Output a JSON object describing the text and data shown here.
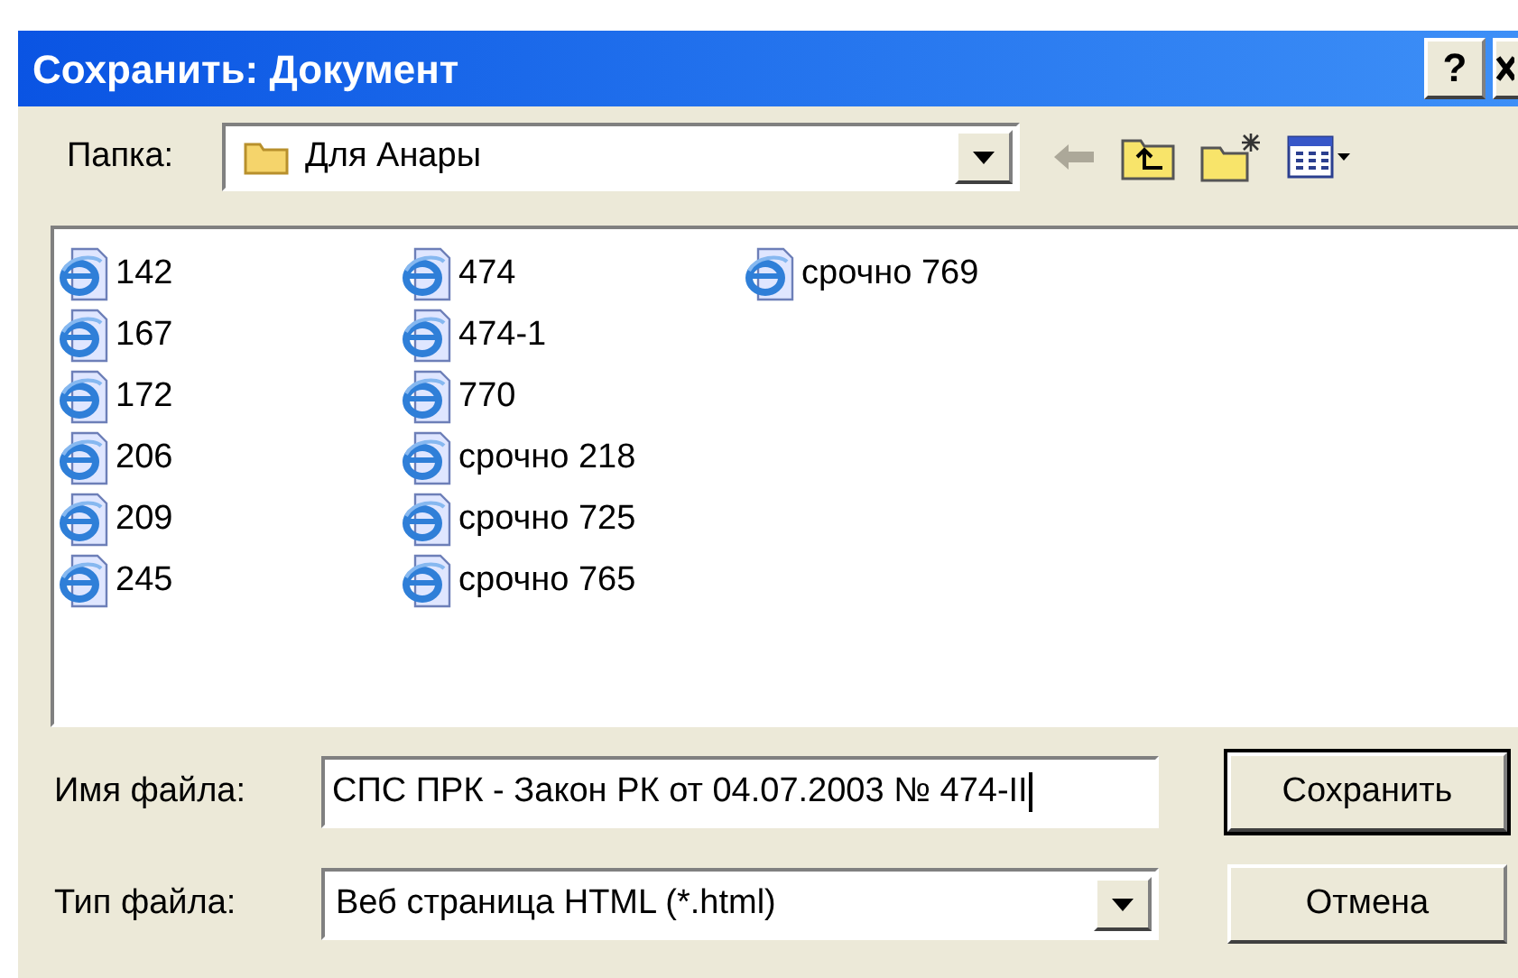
{
  "window": {
    "title": "Сохранить: Документ",
    "help_button": "?"
  },
  "folder": {
    "label": "Папка:",
    "value": "Для Анары"
  },
  "files": {
    "columns": [
      [
        "142",
        "167",
        "172",
        "206",
        "209",
        "245"
      ],
      [
        "474",
        "474-1",
        "770",
        "срочно 218",
        "срочно 725",
        "срочно 765"
      ],
      [
        "срочно 769"
      ]
    ]
  },
  "file_name": {
    "label": "Имя файла:",
    "value": "СПС ПРК - Закон РК от 04.07.2003 № 474-II"
  },
  "file_type": {
    "label": "Тип файла:",
    "value": "Веб страница HTML (*.html)"
  },
  "buttons": [
    {
      "label": "Сохранить",
      "default": true
    },
    {
      "label": "Отмена",
      "default": false
    }
  ]
}
